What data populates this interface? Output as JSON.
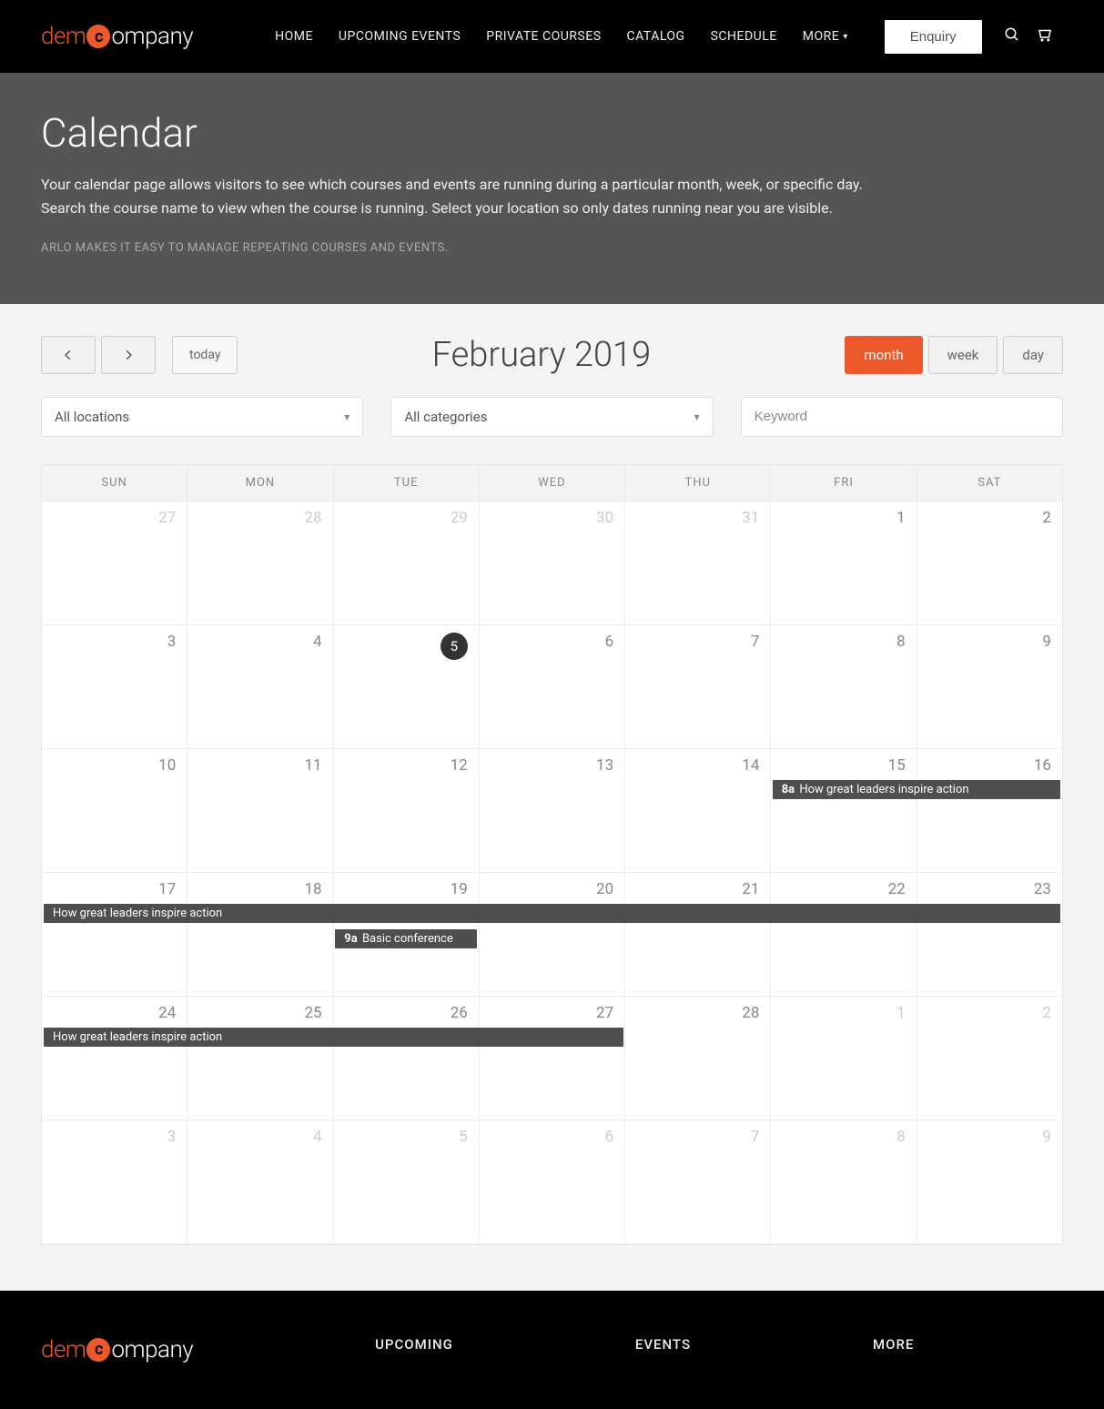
{
  "logo": {
    "part1": "dem",
    "circle": "c",
    "part2": "ompany"
  },
  "nav": {
    "home": "HOME",
    "upcoming": "UPCOMING EVENTS",
    "private": "PRIVATE COURSES",
    "catalog": "CATALOG",
    "schedule": "SCHEDULE",
    "more": "MORE"
  },
  "enquiry": "Enquiry",
  "hero": {
    "title": "Calendar",
    "body": "Your calendar page allows visitors to see which courses and events are running during a particular month, week, or specific day. Search the course name to view when the course is running. Select your location so only dates running near you are visible.",
    "sub": "ARLO MAKES IT EASY TO MANAGE REPEATING COURSES AND EVENTS."
  },
  "cal": {
    "today": "today",
    "title": "February 2019",
    "views": {
      "month": "month",
      "week": "week",
      "day": "day"
    }
  },
  "filters": {
    "locations": "All locations",
    "categories": "All categories",
    "keyword_placeholder": "Keyword"
  },
  "days": {
    "sun": "SUN",
    "mon": "MON",
    "tue": "TUE",
    "wed": "WED",
    "thu": "THU",
    "fri": "FRI",
    "sat": "SAT"
  },
  "grid": [
    [
      {
        "n": "27",
        "o": true
      },
      {
        "n": "28",
        "o": true
      },
      {
        "n": "29",
        "o": true
      },
      {
        "n": "30",
        "o": true
      },
      {
        "n": "31",
        "o": true
      },
      {
        "n": "1"
      },
      {
        "n": "2"
      }
    ],
    [
      {
        "n": "3"
      },
      {
        "n": "4"
      },
      {
        "n": "5",
        "today": true
      },
      {
        "n": "6"
      },
      {
        "n": "7"
      },
      {
        "n": "8"
      },
      {
        "n": "9"
      }
    ],
    [
      {
        "n": "10"
      },
      {
        "n": "11"
      },
      {
        "n": "12"
      },
      {
        "n": "13"
      },
      {
        "n": "14"
      },
      {
        "n": "15"
      },
      {
        "n": "16"
      }
    ],
    [
      {
        "n": "17"
      },
      {
        "n": "18"
      },
      {
        "n": "19"
      },
      {
        "n": "20"
      },
      {
        "n": "21"
      },
      {
        "n": "22"
      },
      {
        "n": "23"
      }
    ],
    [
      {
        "n": "24"
      },
      {
        "n": "25"
      },
      {
        "n": "26"
      },
      {
        "n": "27"
      },
      {
        "n": "28"
      },
      {
        "n": "1",
        "o": true
      },
      {
        "n": "2",
        "o": true
      }
    ],
    [
      {
        "n": "3",
        "o": true
      },
      {
        "n": "4",
        "o": true
      },
      {
        "n": "5",
        "o": true
      },
      {
        "n": "6",
        "o": true
      },
      {
        "n": "7",
        "o": true
      },
      {
        "n": "8",
        "o": true
      },
      {
        "n": "9",
        "o": true
      }
    ]
  ],
  "events": {
    "e1_time": "8a",
    "e1_title": "How great leaders inspire action",
    "e2_title": "How great leaders inspire action",
    "e3_time": "9a",
    "e3_title": "Basic conference",
    "e4_title": "How great leaders inspire action"
  },
  "footer": {
    "upcoming": "UPCOMING",
    "events": "EVENTS",
    "more": "MORE"
  }
}
